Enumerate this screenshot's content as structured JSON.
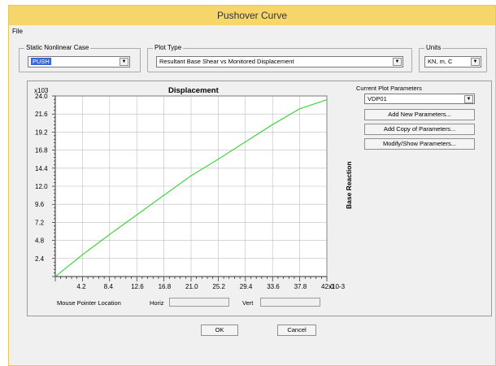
{
  "window": {
    "title": "Pushover Curve",
    "menu": [
      "File"
    ]
  },
  "static_case": {
    "label": "Static Nonlinear Case",
    "value": "PUSH"
  },
  "plot_type": {
    "label": "Plot Type",
    "value": "Resultant Base Shear vs Monitored Displacement"
  },
  "units": {
    "label": "Units",
    "value": "KN, m, C"
  },
  "plot_params": {
    "label": "Current Plot Parameters",
    "value": "VDP01",
    "buttons": [
      "Add New Parameters...",
      "Add Copy of Parameters...",
      "Modify/Show Parameters..."
    ]
  },
  "mouse": {
    "label": "Mouse Pointer Location",
    "horiz_label": "Horiz",
    "vert_label": "Vert",
    "horiz_value": "",
    "vert_value": ""
  },
  "footer": {
    "ok": "OK",
    "cancel": "Cancel"
  },
  "chart_data": {
    "type": "line",
    "title": "Displacement",
    "ylabel": "Base Reaction",
    "x_scale_label": "x10-3",
    "y_scale_label": "x103",
    "xlim": [
      0.0,
      42.0
    ],
    "ylim": [
      0.0,
      24.0
    ],
    "x_ticks": [
      "4.2",
      "8.4",
      "12.6",
      "16.8",
      "21.0",
      "25.2",
      "29.4",
      "33.6",
      "37.8",
      "42.0"
    ],
    "y_ticks": [
      "2.4",
      "4.8",
      "7.2",
      "9.6",
      "12.0",
      "14.4",
      "16.8",
      "19.2",
      "21.6",
      "24.0"
    ],
    "grid": true,
    "line_color": "#30d030",
    "series": [
      {
        "x": [
          0.0,
          4.2,
          8.4,
          12.6,
          16.8,
          21.0,
          25.2,
          29.4,
          33.6,
          37.8,
          42.0
        ],
        "y": [
          0.0,
          2.9,
          5.6,
          8.2,
          10.8,
          13.4,
          15.6,
          17.9,
          20.2,
          22.3,
          23.5
        ]
      }
    ]
  }
}
